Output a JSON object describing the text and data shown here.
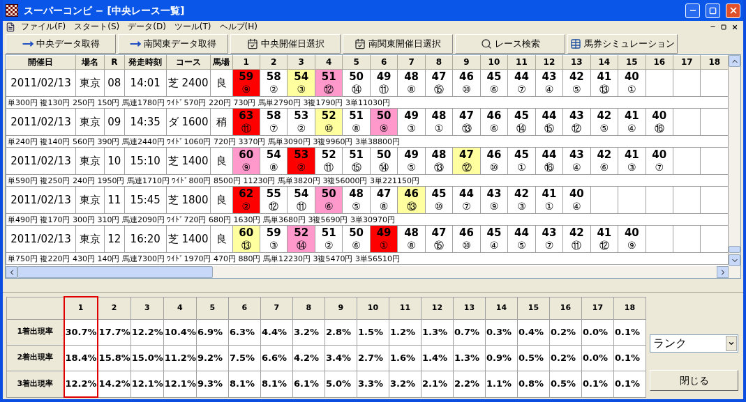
{
  "window": {
    "title": "スーパーコンビ − [中央レース一覧]"
  },
  "menu": [
    "ファイル(F)",
    "スタート(S)",
    "データ(D)",
    "ツール(T)",
    "ヘルプ(H)"
  ],
  "toolbar": [
    {
      "label": "中央データ取得",
      "kind": "fetch"
    },
    {
      "label": "南関東データ取得",
      "kind": "fetch"
    },
    {
      "label": "中央開催日選択",
      "kind": "date"
    },
    {
      "label": "南関東開催日選択",
      "kind": "date"
    },
    {
      "label": "レース検索",
      "kind": "search"
    },
    {
      "label": "馬券シミュレーション",
      "kind": "sim"
    }
  ],
  "grid": {
    "columns": [
      "開催日",
      "場名",
      "R",
      "発走時刻",
      "コース",
      "馬場",
      "1",
      "2",
      "3",
      "4",
      "5",
      "6",
      "7",
      "8",
      "9",
      "10",
      "11",
      "12",
      "13",
      "14",
      "15",
      "16",
      "17",
      "18"
    ],
    "races": [
      {
        "date": "2011/02/13",
        "venue": "東京",
        "race": "08",
        "time": "14:01",
        "course": "芝 2400",
        "going": "良",
        "payout": "単300円 複130円 250円 150円 馬連1780円 ﾜｲﾄﾞ570円 220円 730円 馬単2790円 3複1790円 3単11030円",
        "cells": [
          {
            "score": "59",
            "horse": "⑨",
            "color": "#ff0000"
          },
          {
            "score": "58",
            "horse": "②"
          },
          {
            "score": "54",
            "horse": "③",
            "color": "#ffffa0"
          },
          {
            "score": "51",
            "horse": "⑫",
            "color": "#ff99cc"
          },
          {
            "score": "50",
            "horse": "⑭"
          },
          {
            "score": "49",
            "horse": "⑪"
          },
          {
            "score": "48",
            "horse": "⑧"
          },
          {
            "score": "47",
            "horse": "⑮"
          },
          {
            "score": "46",
            "horse": "⑩"
          },
          {
            "score": "45",
            "horse": "⑥"
          },
          {
            "score": "44",
            "horse": "⑦"
          },
          {
            "score": "43",
            "horse": "④"
          },
          {
            "score": "42",
            "horse": "⑤"
          },
          {
            "score": "41",
            "horse": "⑬"
          },
          {
            "score": "40",
            "horse": "①"
          }
        ]
      },
      {
        "date": "2011/02/13",
        "venue": "東京",
        "race": "09",
        "time": "14:35",
        "course": "ダ 1600",
        "going": "稍",
        "payout": "単240円 複140円 560円 390円 馬連2440円 ﾜｲﾄﾞ1060円 720円 3370円 馬単3090円 3複9960円 3単38800円",
        "cells": [
          {
            "score": "63",
            "horse": "⑪",
            "color": "#ff0000"
          },
          {
            "score": "58",
            "horse": "⑦"
          },
          {
            "score": "53",
            "horse": "②"
          },
          {
            "score": "52",
            "horse": "⑩",
            "color": "#ffffa0"
          },
          {
            "score": "51",
            "horse": "⑧"
          },
          {
            "score": "50",
            "horse": "⑨",
            "color": "#ff99cc"
          },
          {
            "score": "49",
            "horse": "③"
          },
          {
            "score": "48",
            "horse": "①"
          },
          {
            "score": "47",
            "horse": "⑬"
          },
          {
            "score": "46",
            "horse": "⑥"
          },
          {
            "score": "45",
            "horse": "⑭"
          },
          {
            "score": "44",
            "horse": "⑮"
          },
          {
            "score": "43",
            "horse": "⑫"
          },
          {
            "score": "42",
            "horse": "⑤"
          },
          {
            "score": "41",
            "horse": "④"
          },
          {
            "score": "40",
            "horse": "⑯"
          }
        ]
      },
      {
        "date": "2011/02/13",
        "venue": "東京",
        "race": "10",
        "time": "15:10",
        "course": "芝 1400",
        "going": "良",
        "payout": "単590円 複250円 240円 1950円 馬連1710円 ﾜｲﾄﾞ800円 8500円 11230円 馬単3820円 3複56000円 3単221150円",
        "cells": [
          {
            "score": "60",
            "horse": "⑨",
            "color": "#ff99cc"
          },
          {
            "score": "54",
            "horse": "⑧"
          },
          {
            "score": "53",
            "horse": "②",
            "color": "#ff0000"
          },
          {
            "score": "52",
            "horse": "⑪"
          },
          {
            "score": "51",
            "horse": "⑮"
          },
          {
            "score": "50",
            "horse": "⑭"
          },
          {
            "score": "49",
            "horse": "⑤"
          },
          {
            "score": "48",
            "horse": "⑬"
          },
          {
            "score": "47",
            "horse": "⑫",
            "color": "#ffffa0"
          },
          {
            "score": "46",
            "horse": "⑩"
          },
          {
            "score": "45",
            "horse": "①"
          },
          {
            "score": "44",
            "horse": "⑯"
          },
          {
            "score": "43",
            "horse": "④"
          },
          {
            "score": "42",
            "horse": "⑥"
          },
          {
            "score": "41",
            "horse": "③"
          },
          {
            "score": "40",
            "horse": "⑦"
          }
        ]
      },
      {
        "date": "2011/02/13",
        "venue": "東京",
        "race": "11",
        "time": "15:45",
        "course": "芝 1800",
        "going": "良",
        "payout": "単490円 複170円 300円 310円 馬連2090円 ﾜｲﾄﾞ720円 680円 1630円 馬単3680円 3複5690円 3単30970円",
        "cells": [
          {
            "score": "62",
            "horse": "②",
            "color": "#ff0000"
          },
          {
            "score": "55",
            "horse": "⑫"
          },
          {
            "score": "54",
            "horse": "⑪"
          },
          {
            "score": "50",
            "horse": "⑥",
            "color": "#ff99cc"
          },
          {
            "score": "48",
            "horse": "⑤"
          },
          {
            "score": "47",
            "horse": "⑧"
          },
          {
            "score": "46",
            "horse": "⑬",
            "color": "#ffffa0"
          },
          {
            "score": "45",
            "horse": "⑩"
          },
          {
            "score": "44",
            "horse": "⑦"
          },
          {
            "score": "43",
            "horse": "⑨"
          },
          {
            "score": "42",
            "horse": "③"
          },
          {
            "score": "41",
            "horse": "①"
          },
          {
            "score": "40",
            "horse": "④"
          }
        ]
      },
      {
        "date": "2011/02/13",
        "venue": "東京",
        "race": "12",
        "time": "16:20",
        "course": "芝 1400",
        "going": "良",
        "payout": "単750円 複220円 430円 140円 馬連7300円 ﾜｲﾄﾞ1970円 470円 880円 馬単12230円 3複5470円 3単56510円",
        "cells": [
          {
            "score": "60",
            "horse": "⑬",
            "color": "#ffffa0"
          },
          {
            "score": "59",
            "horse": "③"
          },
          {
            "score": "52",
            "horse": "⑭",
            "color": "#ff99cc"
          },
          {
            "score": "51",
            "horse": "②"
          },
          {
            "score": "50",
            "horse": "⑥"
          },
          {
            "score": "49",
            "horse": "①",
            "color": "#ff0000"
          },
          {
            "score": "48",
            "horse": "⑧"
          },
          {
            "score": "47",
            "horse": "⑮"
          },
          {
            "score": "46",
            "horse": "⑩"
          },
          {
            "score": "45",
            "horse": "④"
          },
          {
            "score": "44",
            "horse": "⑤"
          },
          {
            "score": "43",
            "horse": "⑦"
          },
          {
            "score": "42",
            "horse": "⑪"
          },
          {
            "score": "41",
            "horse": "⑫"
          },
          {
            "score": "40",
            "horse": "⑨"
          }
        ]
      }
    ]
  },
  "stats": {
    "columns": [
      {
        "label": "1",
        "selected": true
      },
      {
        "label": "2",
        "selected": false
      },
      {
        "label": "3",
        "selected": false
      },
      {
        "label": "4",
        "selected": false
      },
      {
        "label": "5",
        "selected": false
      },
      {
        "label": "6",
        "selected": false
      },
      {
        "label": "7",
        "selected": false
      },
      {
        "label": "8",
        "selected": false
      },
      {
        "label": "9",
        "selected": false
      },
      {
        "label": "10",
        "selected": false
      },
      {
        "label": "11",
        "selected": false
      },
      {
        "label": "12",
        "selected": false
      },
      {
        "label": "13",
        "selected": false
      },
      {
        "label": "14",
        "selected": false
      },
      {
        "label": "15",
        "selected": false
      },
      {
        "label": "16",
        "selected": false
      },
      {
        "label": "17",
        "selected": false
      },
      {
        "label": "18",
        "selected": false
      }
    ],
    "rows": [
      {
        "label": "1着出現率",
        "values": [
          "30.7%",
          "17.7%",
          "12.2%",
          "10.4%",
          "6.9%",
          "6.3%",
          "4.4%",
          "3.2%",
          "2.8%",
          "1.5%",
          "1.2%",
          "1.3%",
          "0.7%",
          "0.3%",
          "0.4%",
          "0.2%",
          "0.0%",
          "0.1%"
        ]
      },
      {
        "label": "2着出現率",
        "values": [
          "18.4%",
          "15.8%",
          "15.0%",
          "11.2%",
          "9.2%",
          "7.5%",
          "6.6%",
          "4.2%",
          "3.4%",
          "2.7%",
          "1.6%",
          "1.4%",
          "1.3%",
          "0.9%",
          "0.5%",
          "0.2%",
          "0.0%",
          "0.1%"
        ]
      },
      {
        "label": "3着出現率",
        "values": [
          "12.2%",
          "14.2%",
          "12.1%",
          "12.1%",
          "9.3%",
          "8.1%",
          "8.1%",
          "6.1%",
          "5.0%",
          "3.3%",
          "3.2%",
          "2.1%",
          "2.2%",
          "1.1%",
          "0.8%",
          "0.5%",
          "0.1%",
          "0.1%"
        ]
      }
    ]
  },
  "rank_select": {
    "value": "ランク"
  },
  "close_button": "閉じる"
}
